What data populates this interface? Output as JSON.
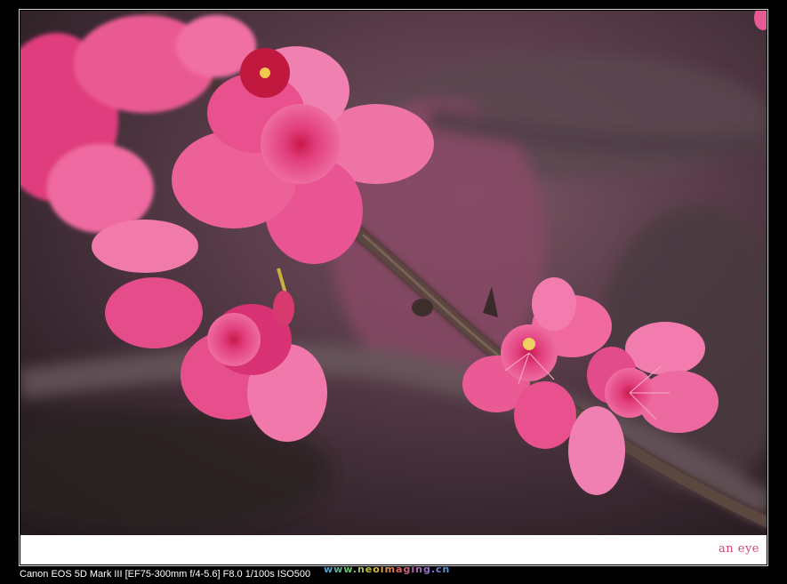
{
  "photo": {
    "subject": "pink-cherry-blossoms-on-branch",
    "colors": {
      "background_dark": "#2e2228",
      "background_mauve": "#6b4a58",
      "petal_pink": "#e8488a",
      "petal_light": "#f07aa8",
      "petal_center": "#c01840",
      "branch": "#4a3a36",
      "stamen": "#f0d060"
    }
  },
  "caption": {
    "signature": "an eye"
  },
  "exif": {
    "text": "Canon EOS 5D Mark III [EF75-300mm f/4-5.6] F8.0 1/100s ISO500"
  },
  "watermark": {
    "text": "www.neoimaging.cn"
  }
}
